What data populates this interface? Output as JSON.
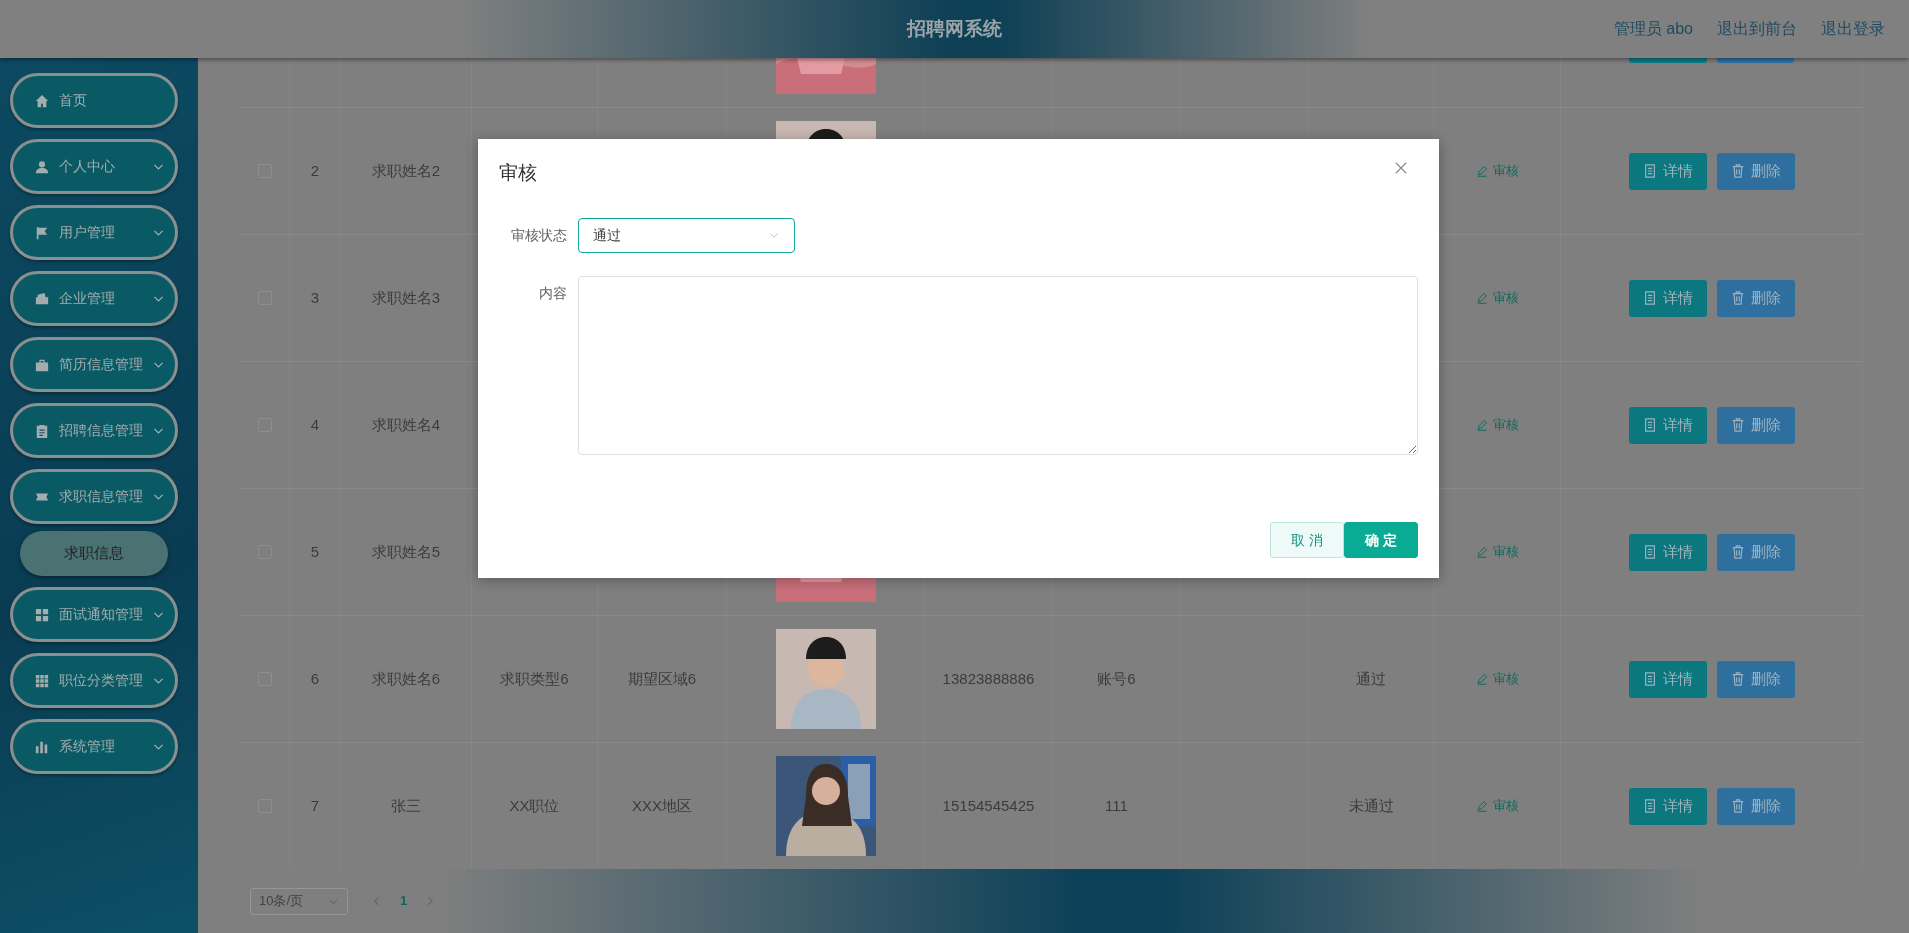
{
  "header": {
    "title": "招聘网系统",
    "links": [
      "管理员 abo",
      "退出到前台",
      "退出登录"
    ]
  },
  "sidebar": {
    "items": [
      {
        "label": "首页",
        "expandable": false
      },
      {
        "label": "个人中心",
        "expandable": true
      },
      {
        "label": "用户管理",
        "expandable": true
      },
      {
        "label": "企业管理",
        "expandable": true
      },
      {
        "label": "简历信息管理",
        "expandable": true
      },
      {
        "label": "招聘信息管理",
        "expandable": true
      },
      {
        "label": "求职信息管理",
        "expandable": true,
        "children": [
          {
            "label": "求职信息"
          }
        ]
      },
      {
        "label": "面试通知管理",
        "expandable": true
      },
      {
        "label": "职位分类管理",
        "expandable": true
      },
      {
        "label": "系统管理",
        "expandable": true
      }
    ]
  },
  "table": {
    "rows": [
      {
        "kind": "partial",
        "photo": {
          "kind": "picture"
        }
      },
      {
        "kind": "full",
        "checked": false,
        "index": "2",
        "name": "求职姓名2",
        "photo": {
          "kind": "picture"
        },
        "audit": "审核",
        "actions": [
          "详情",
          "删除"
        ]
      },
      {
        "kind": "full",
        "checked": false,
        "index": "3",
        "name": "求职姓名3",
        "audit": "审核",
        "actions": [
          "详情",
          "删除"
        ]
      },
      {
        "kind": "full",
        "checked": false,
        "index": "4",
        "name": "求职姓名4",
        "audit": "审核",
        "actions": [
          "详情",
          "删除"
        ]
      },
      {
        "kind": "full",
        "checked": false,
        "index": "5",
        "name": "求职姓名5",
        "photo": {
          "kind": "picture"
        },
        "audit": "审核",
        "actions": [
          "详情",
          "删除"
        ]
      },
      {
        "kind": "full",
        "checked": false,
        "index": "6",
        "name": "求职姓名6",
        "type": "求职类型6",
        "area": "期望区域6",
        "photo": {
          "kind": "picture"
        },
        "phone": "13823888886",
        "account": "账号6",
        "status": "通过",
        "audit": "审核",
        "actions": [
          "详情",
          "删除"
        ]
      },
      {
        "kind": "full",
        "checked": false,
        "index": "7",
        "name": "张三",
        "type": "XX职位",
        "area": "XXX地区",
        "photo": {
          "kind": "picture"
        },
        "phone": "15154545425",
        "account": "111",
        "status": "未通过",
        "audit": "审核",
        "actions": [
          "详情",
          "删除"
        ]
      }
    ]
  },
  "pagination": {
    "page_size": "10条/页",
    "pages": [
      {
        "label": "1",
        "selected": true
      }
    ]
  },
  "dialog": {
    "title": "审核",
    "fields": [
      {
        "kind": "select",
        "label": "审核状态",
        "value": "通过"
      },
      {
        "kind": "textarea",
        "label": "内容"
      }
    ],
    "buttons": [
      {
        "kind": "secondary",
        "label": "取 消"
      },
      {
        "kind": "primary",
        "label": "确 定"
      }
    ]
  }
}
